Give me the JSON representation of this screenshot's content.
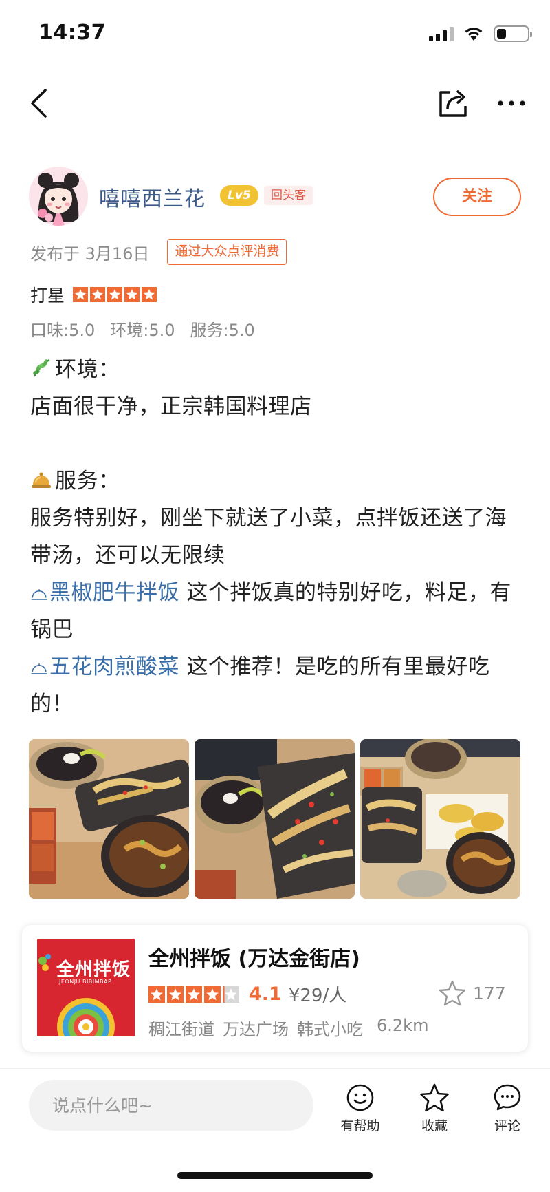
{
  "status_bar": {
    "time": "14:37"
  },
  "author": {
    "name": "嘻嘻西兰花",
    "level": "Lv5",
    "badge": "回头客",
    "follow_label": "关注"
  },
  "meta": {
    "published": "发布于 3月16日",
    "verified": "通过大众点评消费"
  },
  "rating": {
    "label": "打星",
    "stars": 5,
    "sub_scores": [
      "口味:5.0",
      "环境:5.0",
      "服务:5.0"
    ]
  },
  "content": {
    "env_heading": "环境：",
    "env_text": "店面很干净，正宗韩国料理店",
    "service_heading": "服务：",
    "service_text": "服务特别好，刚坐下就送了小菜，点拌饭还送了海带汤，还可以无限续",
    "dish1_name": "黑椒肥牛拌饭",
    "dish1_text": " 这个拌饭真的特别好吃，料足，有锅巴",
    "dish2_name": "五花肉煎酸菜",
    "dish2_text": " 这个推荐！是吃的所有里最好吃的！"
  },
  "photos": [
    "photo-1",
    "photo-2",
    "photo-3"
  ],
  "shop": {
    "name": "全州拌饭 (万达金街店)",
    "logo_text": "全州拌饭",
    "logo_sub": "JEONJU BIBIMBAP",
    "score": "4.1",
    "stars": 4,
    "price": "¥29/人",
    "collect_count": "177",
    "area": "稠江街道",
    "mall": "万达广场",
    "category": "韩式小吃",
    "distance": "6.2km"
  },
  "bottom_bar": {
    "comment_placeholder": "说点什么吧~",
    "helpful_label": "有帮助",
    "collect_label": "收藏",
    "comment_label": "评论"
  },
  "colors": {
    "accent": "#f06a35",
    "link": "#3a6ea8",
    "username": "#3c5a8a"
  }
}
